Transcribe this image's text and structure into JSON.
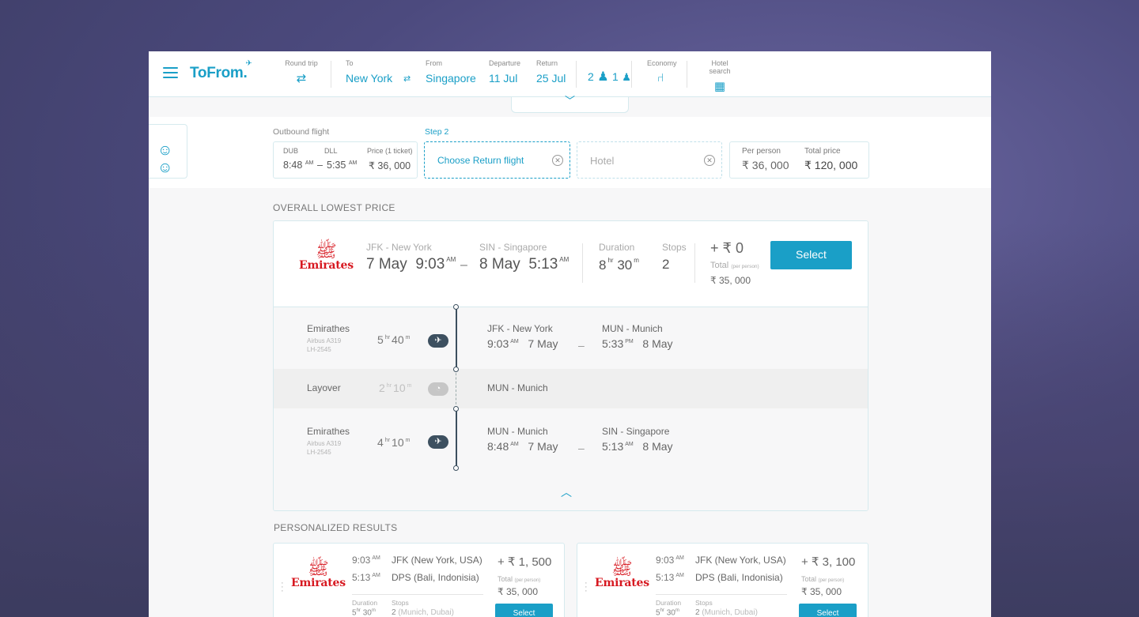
{
  "header": {
    "brand": "ToFrom.",
    "round_trip_label": "Round trip",
    "to_label": "To",
    "to_value": "New York",
    "from_label": "From",
    "from_value": "Singapore",
    "departure_label": "Departure",
    "departure_value": "11 Jul",
    "return_label": "Return",
    "return_value": "25 Jul",
    "adults": "2",
    "children": "1",
    "class_label": "Economy",
    "hotel_label": "Hotel search"
  },
  "summary": {
    "outbound_label": "Outbound flight",
    "origin_code": "DUB",
    "dest_code": "DLL",
    "price_label": "Price (1 ticket)",
    "depart_time": "8:48",
    "depart_ampm": "AM",
    "arrive_time": "5:35",
    "arrive_ampm": "AM",
    "price": "₹ 36, 000",
    "step_label": "Step 2",
    "return_placeholder": "Choose Return flight",
    "hotel_placeholder": "Hotel",
    "per_person_label": "Per person",
    "per_person_value": "₹ 36, 000",
    "total_label": "Total price",
    "total_value": "₹ 120, 000"
  },
  "lowest": {
    "section_title": "OVERALL LOWEST PRICE",
    "airline_logo": "Emirates",
    "from_city": "JFK - New York",
    "from_date": "7 May",
    "from_time": "9:03",
    "from_ampm": "AM",
    "to_city": "SIN - Singapore",
    "to_date": "8 May",
    "to_time": "5:13",
    "to_ampm": "AM",
    "duration_label": "Duration",
    "duration_hr": "8",
    "duration_min": "30",
    "hr_unit": "hr",
    "min_unit": "m",
    "stops_label": "Stops",
    "stops": "2",
    "price_add": "+ ₹ 0",
    "total_label": "Total",
    "per_person": "(per person)",
    "total_value": "₹ 35, 000",
    "select_label": "Select",
    "legs": [
      {
        "airline": "Emirathes",
        "aircraft": "Airbus A319",
        "flight": "LH-2545",
        "hr": "5",
        "min": "40",
        "from_city": "JFK - New York",
        "from_time": "9:03",
        "from_ampm": "AM",
        "from_date": "7 May",
        "to_city": "MUN - Munich",
        "to_time": "5:33",
        "to_ampm": "PM",
        "to_date": "8 May"
      },
      {
        "airline": "Emirathes",
        "aircraft": "Airbus A319",
        "flight": "LH-2545",
        "hr": "4",
        "min": "10",
        "from_city": "MUN - Munich",
        "from_time": "8:48",
        "from_ampm": "AM",
        "from_date": "7 May",
        "to_city": "SIN - Singapore",
        "to_time": "5:13",
        "to_ampm": "AM",
        "to_date": "8 May"
      }
    ],
    "layover": {
      "label": "Layover",
      "hr": "2",
      "min": "10",
      "city": "MUN - Munich"
    }
  },
  "personalized": {
    "section_title": "PERSONALIZED RESULTS",
    "cards": [
      {
        "airline_logo": "Emirates",
        "depart_time": "9:03",
        "depart_ampm": "AM",
        "depart_place": "JFK (New York, USA)",
        "arrive_time": "5:13",
        "arrive_ampm": "AM",
        "arrive_place": "DPS (Bali, Indonisia)",
        "duration_label": "Duration",
        "stops_label": "Stops",
        "duration_hr": "5",
        "duration_min": "30",
        "stops": "2",
        "stops_via": "(Munich, Dubai)",
        "price_add": "+ ₹ 1, 500",
        "total_label": "Total",
        "per_person": "(per person)",
        "total_value": "₹ 35, 000",
        "select_label": "Select"
      },
      {
        "airline_logo": "Emirates",
        "depart_time": "9:03",
        "depart_ampm": "AM",
        "depart_place": "JFK (New York, USA)",
        "arrive_time": "5:13",
        "arrive_ampm": "AM",
        "arrive_place": "DPS (Bali, Indonisia)",
        "duration_label": "Duration",
        "stops_label": "Stops",
        "duration_hr": "5",
        "duration_min": "30",
        "stops": "2",
        "stops_via": "(Munich, Dubai)",
        "price_add": "+ ₹ 3, 100",
        "total_label": "Total",
        "per_person": "(per person)",
        "total_value": "₹ 35, 000",
        "select_label": "Select"
      }
    ]
  },
  "colors": {
    "accent": "#1a9fc7",
    "emirates_red": "#d71921",
    "timeline": "#3d5060"
  }
}
